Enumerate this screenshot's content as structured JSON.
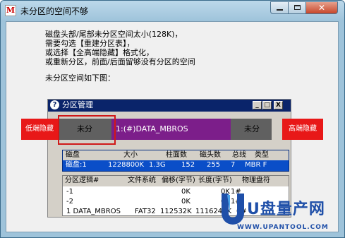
{
  "window": {
    "app_icon_glyph": "M",
    "title": "未分区的空间不够",
    "controls": {
      "minimize": "minimize",
      "maximize": "maximize",
      "close": "✕"
    }
  },
  "message": {
    "lines": [
      "磁盘头部/尾部未分区空间太小(128K)，",
      "需要勾选【重建分区表】，",
      "或选择【全高端隐藏】格式化，",
      "或重新分区，前面/后面留够没有分区的空间"
    ],
    "caption": "未分区空间如下图："
  },
  "illustration": {
    "window_icon": "?",
    "window_title": "分区管理",
    "window_buttons": [
      "_",
      "□",
      "X"
    ],
    "partition_bar": {
      "left_label": "低端隐藏",
      "left_free": "未分",
      "main_partition": "1:(#)DATA_MBROS",
      "right_free": "未分",
      "right_label": "高端隐藏"
    },
    "disk_table": {
      "headers": [
        "磁盘",
        "大小",
        "柱面数",
        "磁头数",
        "总线",
        "类型"
      ],
      "row": [
        "磁盘:1",
        "1228800K",
        "1.3G",
        "152",
        "255",
        "7",
        "MBR F"
      ]
    },
    "logical_table": {
      "headers": [
        "分区逻辑#",
        "文件系统",
        "偏移(字节)",
        "长度(字节)",
        "物理盘符"
      ],
      "rows": [
        [
          "-1",
          "",
          "0K",
          "0K",
          "1#"
        ],
        [
          "-2",
          "",
          "0K",
          "0K",
          "1#"
        ],
        [
          "1 DATA_MBROS",
          "FAT32",
          "112532K",
          "1116248K",
          "0#"
        ]
      ]
    }
  },
  "watermark": {
    "brand": "U盘量产网",
    "url": "WWW.UPANTOOL.COM"
  },
  "colors": {
    "partition_main": "#7c1e8a",
    "unallocated": "#606060",
    "hidden_tag": "#e81818",
    "highlight_border": "#d01818",
    "selected_row": "#0a4ec8",
    "watermark": "#1f4fa8"
  }
}
